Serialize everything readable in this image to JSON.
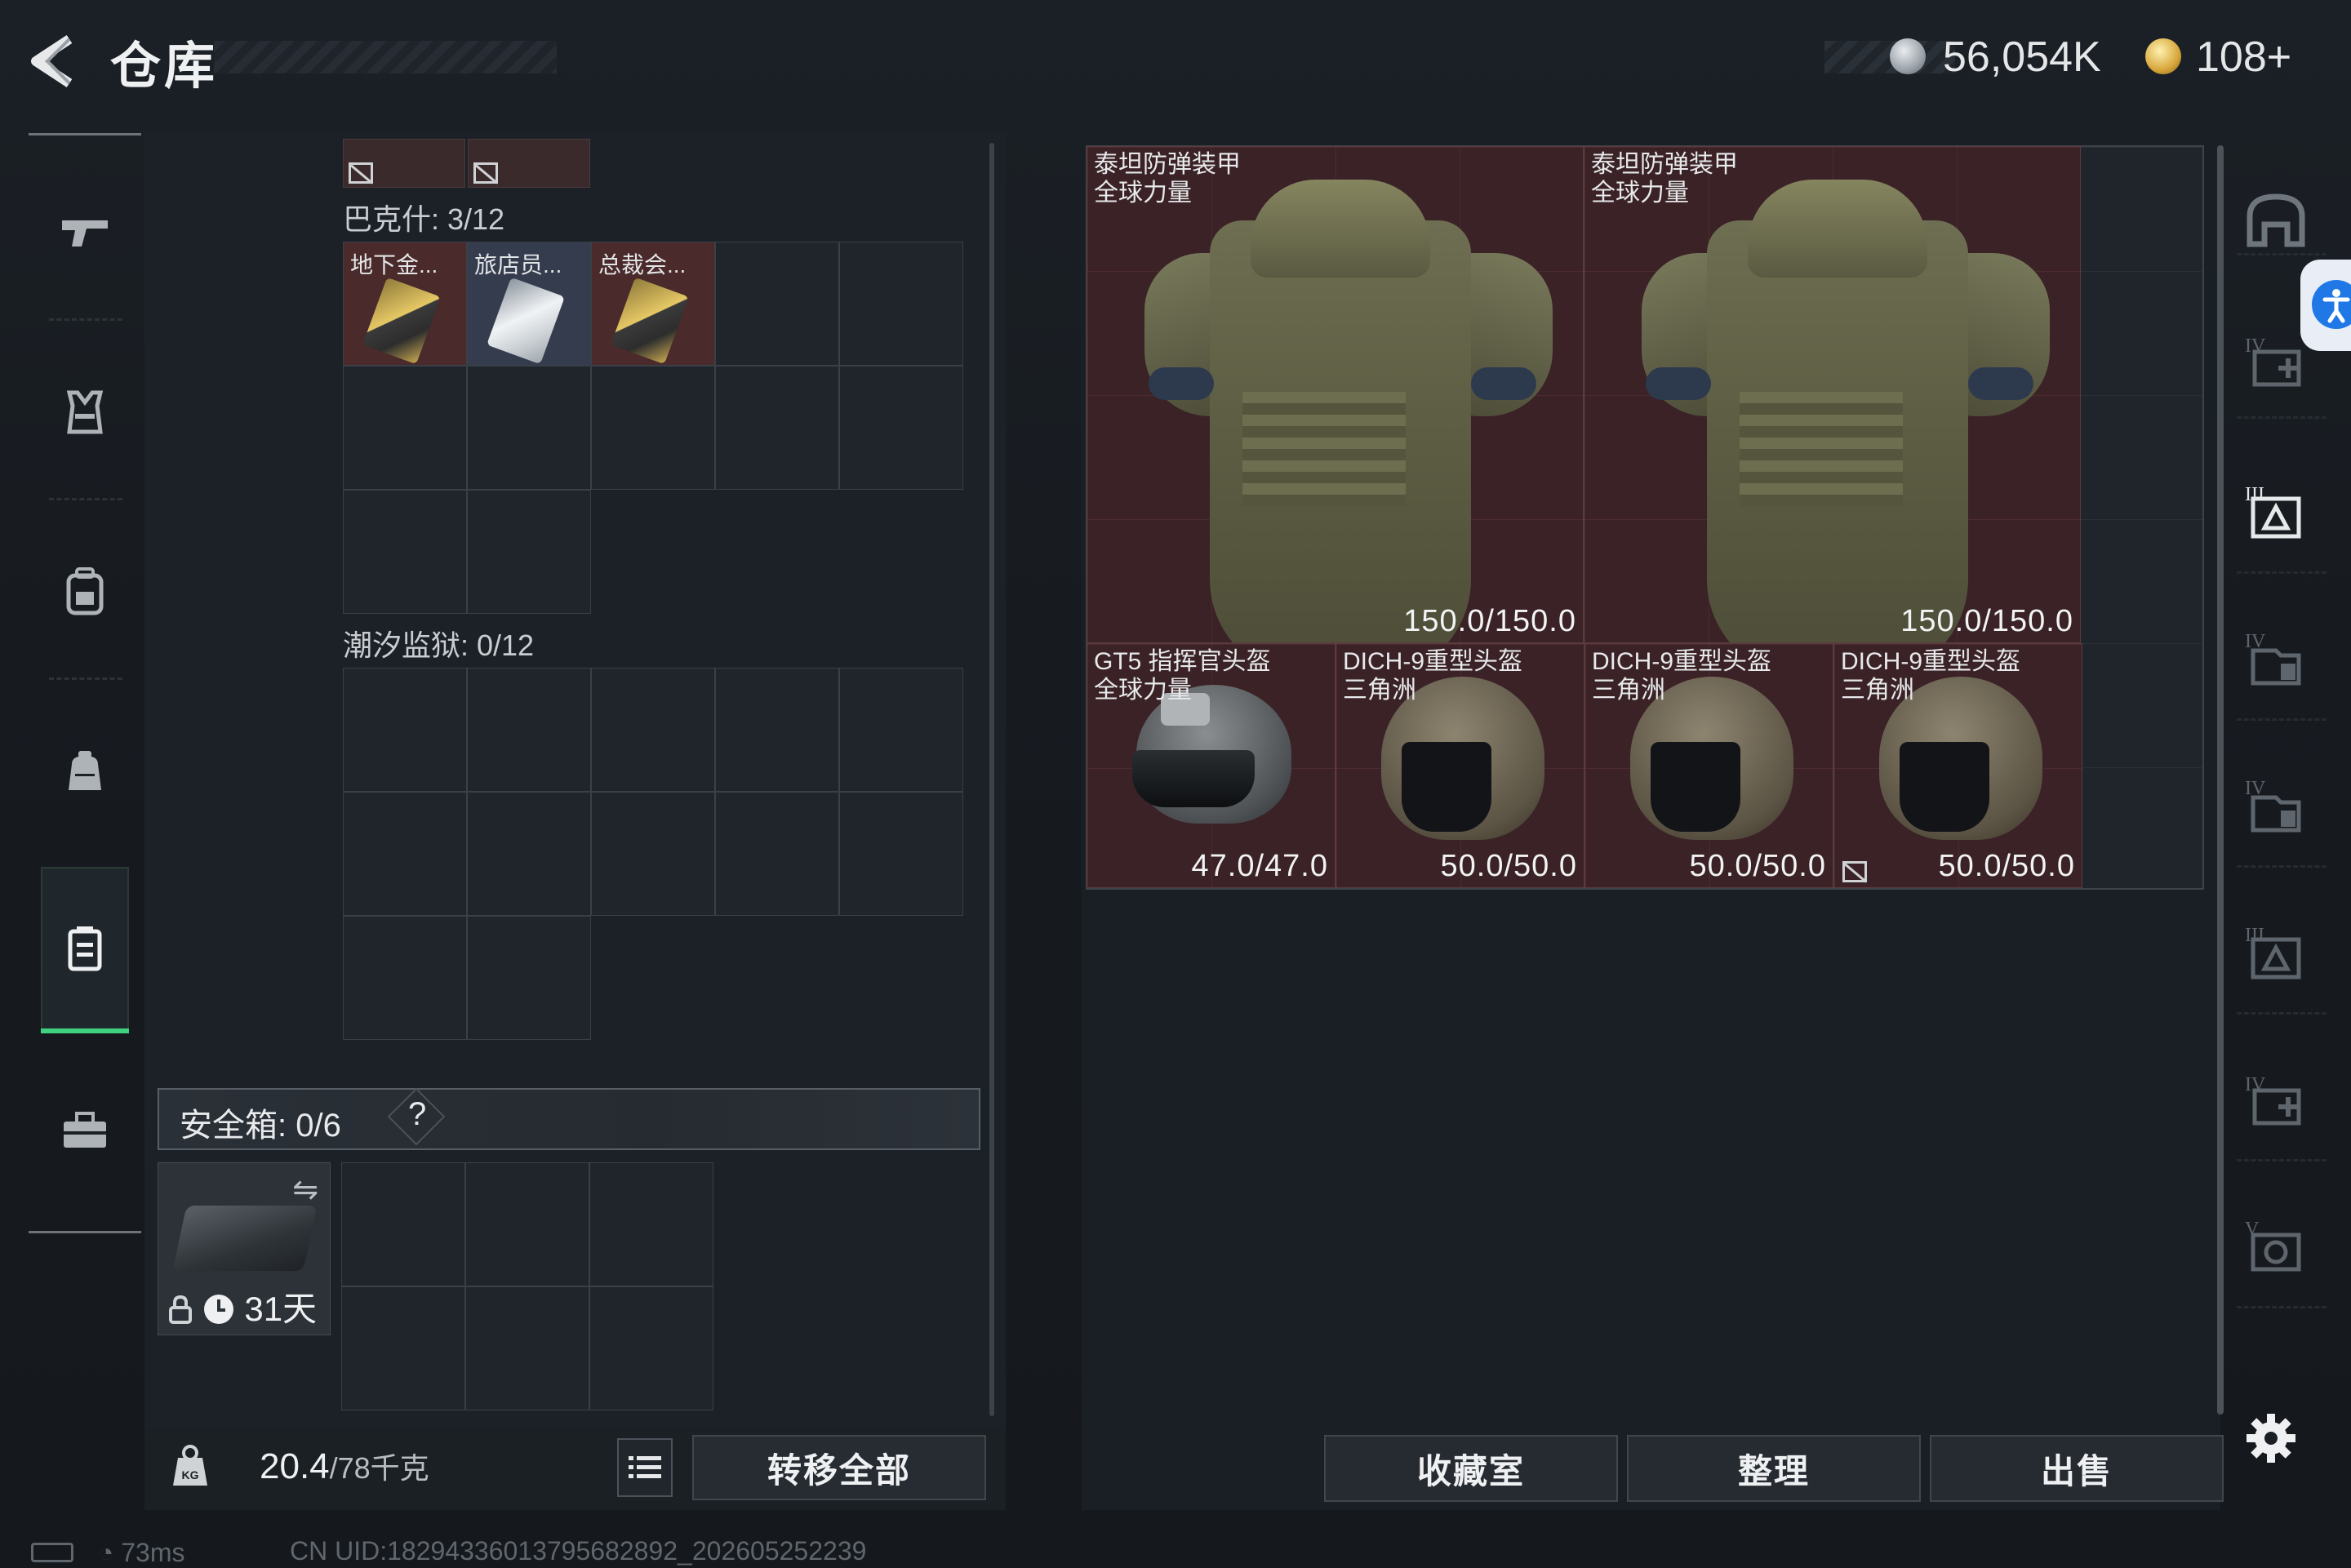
{
  "header": {
    "title": "仓库",
    "currency_silver": "56,054K",
    "currency_gold": "108+"
  },
  "sidebar": {
    "items": [
      {
        "name": "weapons",
        "icon": "gun-icon"
      },
      {
        "name": "armor-rig",
        "icon": "rig-icon"
      },
      {
        "name": "backpack",
        "icon": "backpack-icon"
      },
      {
        "name": "bag",
        "icon": "bag-icon"
      },
      {
        "name": "keycards",
        "icon": "keycard-case-icon",
        "active": true
      },
      {
        "name": "toolbox",
        "icon": "toolbox-icon"
      }
    ]
  },
  "left_panel": {
    "sections": [
      {
        "label": "巴克什: 3/12",
        "items": [
          {
            "name": "地下金...",
            "rarity": "gold"
          },
          {
            "name": "旅店员...",
            "rarity": "silver"
          },
          {
            "name": "总裁会...",
            "rarity": "gold"
          }
        ]
      },
      {
        "label": "潮汐监狱: 0/12",
        "items": []
      }
    ],
    "safe_box": {
      "label": "安全箱:",
      "count": "0/6",
      "help": "?",
      "timer": "31天"
    },
    "weight": {
      "current": "20.4",
      "max": "/78千克"
    },
    "transfer_all": "转移全部"
  },
  "stash": {
    "items": [
      {
        "name": "泰坦防弹装甲\n全球力量",
        "durability": "150.0/150.0",
        "kind": "armor"
      },
      {
        "name": "泰坦防弹装甲\n全球力量",
        "durability": "150.0/150.0",
        "kind": "armor"
      },
      {
        "name": "GT5 指挥官头盔\n全球力量",
        "durability": "47.0/47.0",
        "kind": "helmet-gt5"
      },
      {
        "name": "DICH-9重型头盔\n三角洲",
        "durability": "50.0/50.0",
        "kind": "helmet-dich"
      },
      {
        "name": "DICH-9重型头盔\n三角洲",
        "durability": "50.0/50.0",
        "kind": "helmet-dich"
      },
      {
        "name": "DICH-9重型头盔\n三角洲",
        "durability": "50.0/50.0",
        "kind": "helmet-dich"
      }
    ]
  },
  "bottom_buttons": {
    "collection": "收藏室",
    "sort": "整理",
    "sell": "出售"
  },
  "right_sidebar": {
    "tabs": [
      "helmet-tab-icon",
      "stash-IV-add-icon",
      "stash-III-icon",
      "stash-IV-icon",
      "stash-IV-icon",
      "stash-III-icon",
      "stash-IV-add-icon",
      "stash-V-icon"
    ]
  },
  "status": {
    "ping": "73ms",
    "uid": "CN UID:18294336013795682892_202605252239"
  }
}
